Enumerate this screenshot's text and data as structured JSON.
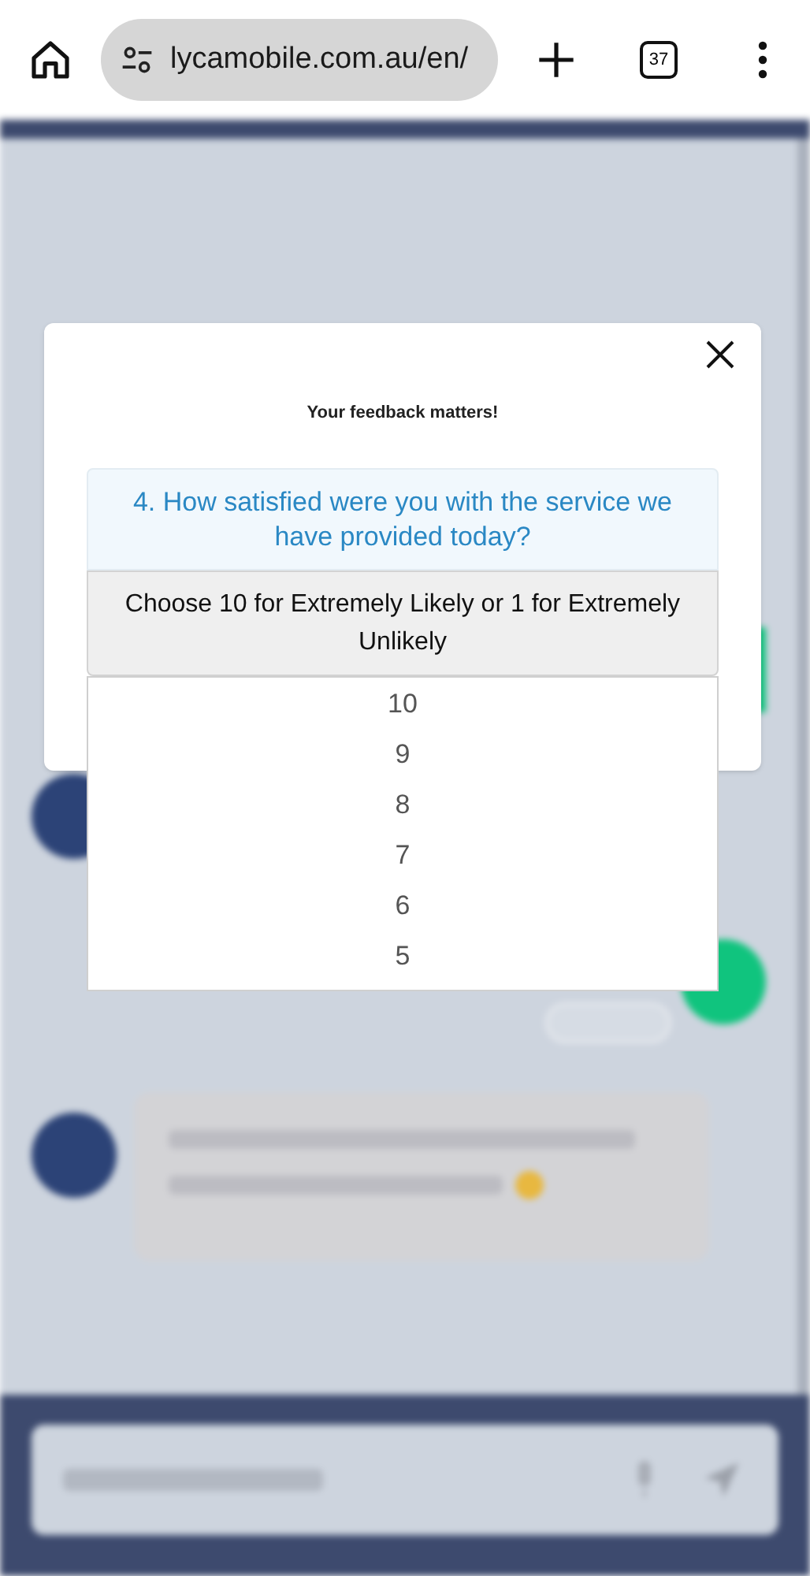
{
  "browser": {
    "url": "lycamobile.com.au/en/",
    "tab_count": "37"
  },
  "modal": {
    "title": "Your feedback matters!",
    "question": "4. How satisfied were you with the service we have provided today?",
    "instruction": "Choose 10 for Extremely Likely or 1 for Extremely Unlikely",
    "options": [
      "10",
      "9",
      "8",
      "7",
      "6",
      "5"
    ]
  }
}
